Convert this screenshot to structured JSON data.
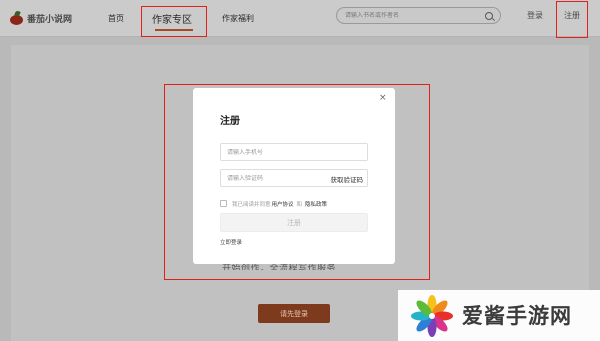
{
  "header": {
    "logo_text": "番茄小说网",
    "nav": {
      "home": "首页",
      "author_zone": "作家专区",
      "author_welfare": "作家福利"
    },
    "search_placeholder": "请输入书名或作者名",
    "login": "登录",
    "register": "注册"
  },
  "background_page": {
    "partial_text": "开始创作，全流程写作服务",
    "login_first_button": "请先登录"
  },
  "modal": {
    "close": "×",
    "title": "注册",
    "phone_placeholder": "请输入手机号",
    "code_placeholder": "请输入验证码",
    "get_code": "获取验证码",
    "agree_prefix": "我已阅读并同意",
    "user_agreement": "用户协议",
    "and": "和",
    "privacy_policy": "隐私政策",
    "submit": "注册",
    "login_now": "立即登录"
  },
  "watermark": {
    "text": "爱酱手游网"
  },
  "colors": {
    "accent": "#a94a24",
    "annotation_red": "#e0201b",
    "overlay": "#b9b9b9"
  }
}
